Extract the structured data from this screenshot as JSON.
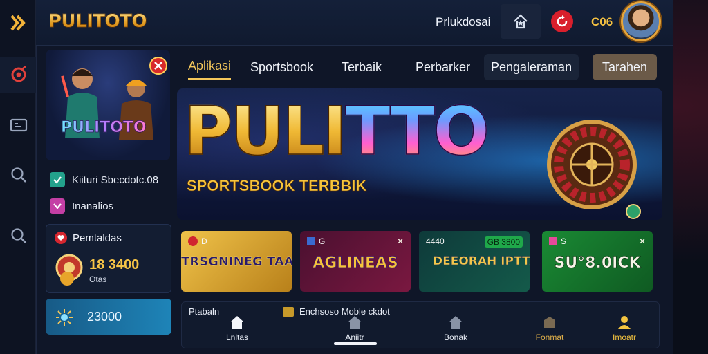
{
  "header": {
    "brand": "PULITOTO",
    "link": "Prlukdosai",
    "coins": "C06",
    "accent": "#f4c75b"
  },
  "rail": {
    "icons": [
      "play-icon",
      "target-icon",
      "ticket-icon",
      "search-icon",
      "search-icon"
    ]
  },
  "promo": {
    "logo": "PULITOTO"
  },
  "side_list": [
    {
      "label": "Kiituri Sbecdotc.08",
      "icon": "check-icon"
    },
    {
      "label": "Inanalios",
      "icon": "check-icon"
    }
  ],
  "rewards": {
    "title": "Pemtaldas",
    "amount": "18 3400",
    "sub": "Otas"
  },
  "balance": {
    "value": "23000"
  },
  "tabs": [
    {
      "label": "Aplikasi",
      "active": true
    },
    {
      "label": "Sportsbook",
      "active": false
    },
    {
      "label": "Terbaik",
      "active": false
    },
    {
      "label": "Perbarker",
      "active": false
    },
    {
      "label": "Pengaleraman",
      "active": false
    },
    {
      "label": "Tarahen",
      "active": false
    }
  ],
  "hero": {
    "title_a": "PULI",
    "title_b": "TTO",
    "subtitle": "SPORTSBOOK TERBBIK"
  },
  "games": [
    {
      "tag": "D",
      "tag_right": "",
      "title": "TRSGNINEG TAANAS"
    },
    {
      "tag": "G",
      "tag_right": "✕",
      "title": "AGLINEAS"
    },
    {
      "tag": "4440",
      "tag_right": "GB 3800",
      "title": "DEEORAH IPTTAROR"
    },
    {
      "tag": "S",
      "tag_right": "✕",
      "title": "SU°8.0ICK"
    }
  ],
  "bottom": {
    "label1": "Ptabaln",
    "label2": "Enchsoso Moble ckdot",
    "nav": [
      {
        "label": "Lnltas"
      },
      {
        "label": "Aniitr"
      },
      {
        "label": "Bonak"
      },
      {
        "label": "Fonmat"
      },
      {
        "label": "Imoatr"
      }
    ]
  }
}
